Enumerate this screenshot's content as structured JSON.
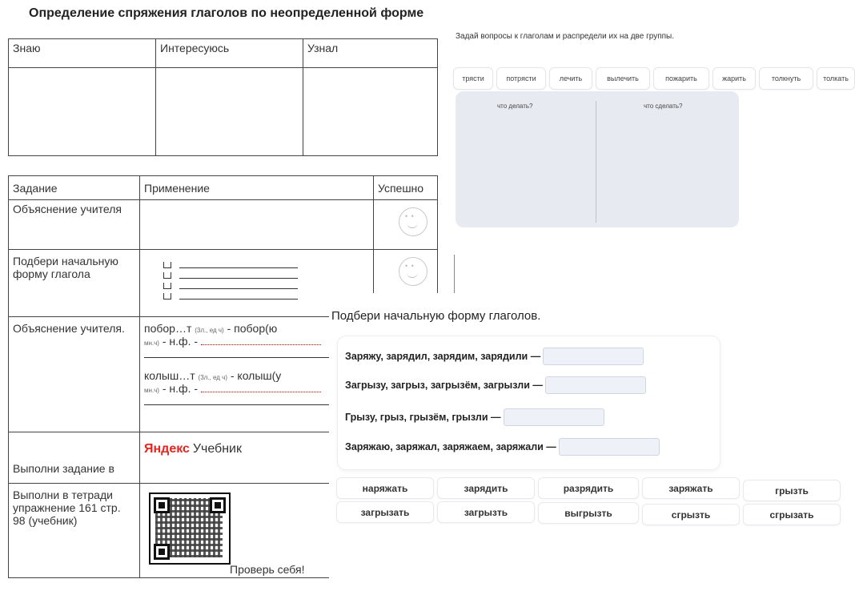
{
  "doc": {
    "title": "Определение спряжения глаголов по неопределенной форме",
    "top_table": {
      "headers": [
        "Знаю",
        "Интересуюсь",
        "Узнал"
      ]
    },
    "main_table": {
      "headers": [
        "Задание",
        "Применение",
        "Успешно"
      ],
      "row1": {
        "task": "Объяснение учителя"
      },
      "row2": {
        "task": "Подбери начальную форму глагола"
      },
      "row3": {
        "task": "Объяснение учителя.",
        "line1_a": "побор…т",
        "line1_note": "(3л., ед ч)",
        "line1_b": " - побор(ю",
        "line1_note2": "мн.ч)",
        "line1_c": " - н.ф. -",
        "line2_a": "колыш…т",
        "line2_note": "(3л., ед ч)",
        "line2_b": " - колыш(у",
        "line2_note2": "мн.ч)",
        "line2_c": " - н.ф. -"
      },
      "row4": {
        "task": "Выполни задание в",
        "brand_a": "Яндекс",
        "brand_b": "Учебник"
      },
      "row5": {
        "task": "Выполни в тетради упражнение 161 стр. 98 (учебник)",
        "check": "Проверь себя!"
      }
    }
  },
  "panel_sort": {
    "instruction": "Задай вопросы к глаголам и распредели их на две группы.",
    "verbs": [
      "трясти",
      "потрясти",
      "лечить",
      "вылечить",
      "пожарить",
      "жарить",
      "толкнуть",
      "толкать"
    ],
    "col_left": "что делать?",
    "col_right": "что сделать?"
  },
  "panel_forms": {
    "instruction": "Подбери начальную форму глаголов.",
    "questions": [
      "Заряжу, зарядил, зарядим, зарядили —",
      "Загрызу, загрыз, загрызём, загрызли —",
      "Грызу, грыз, грызём, грызли —",
      "Заряжаю, заряжал, заряжаем, заряжали —"
    ],
    "answers_row1": [
      "наряжать",
      "зарядить",
      "разрядить",
      "заряжать",
      "грызть"
    ],
    "answers_row2": [
      "загрызать",
      "загрызть",
      "выгрызть",
      "сгрызть",
      "сгрызать"
    ]
  }
}
